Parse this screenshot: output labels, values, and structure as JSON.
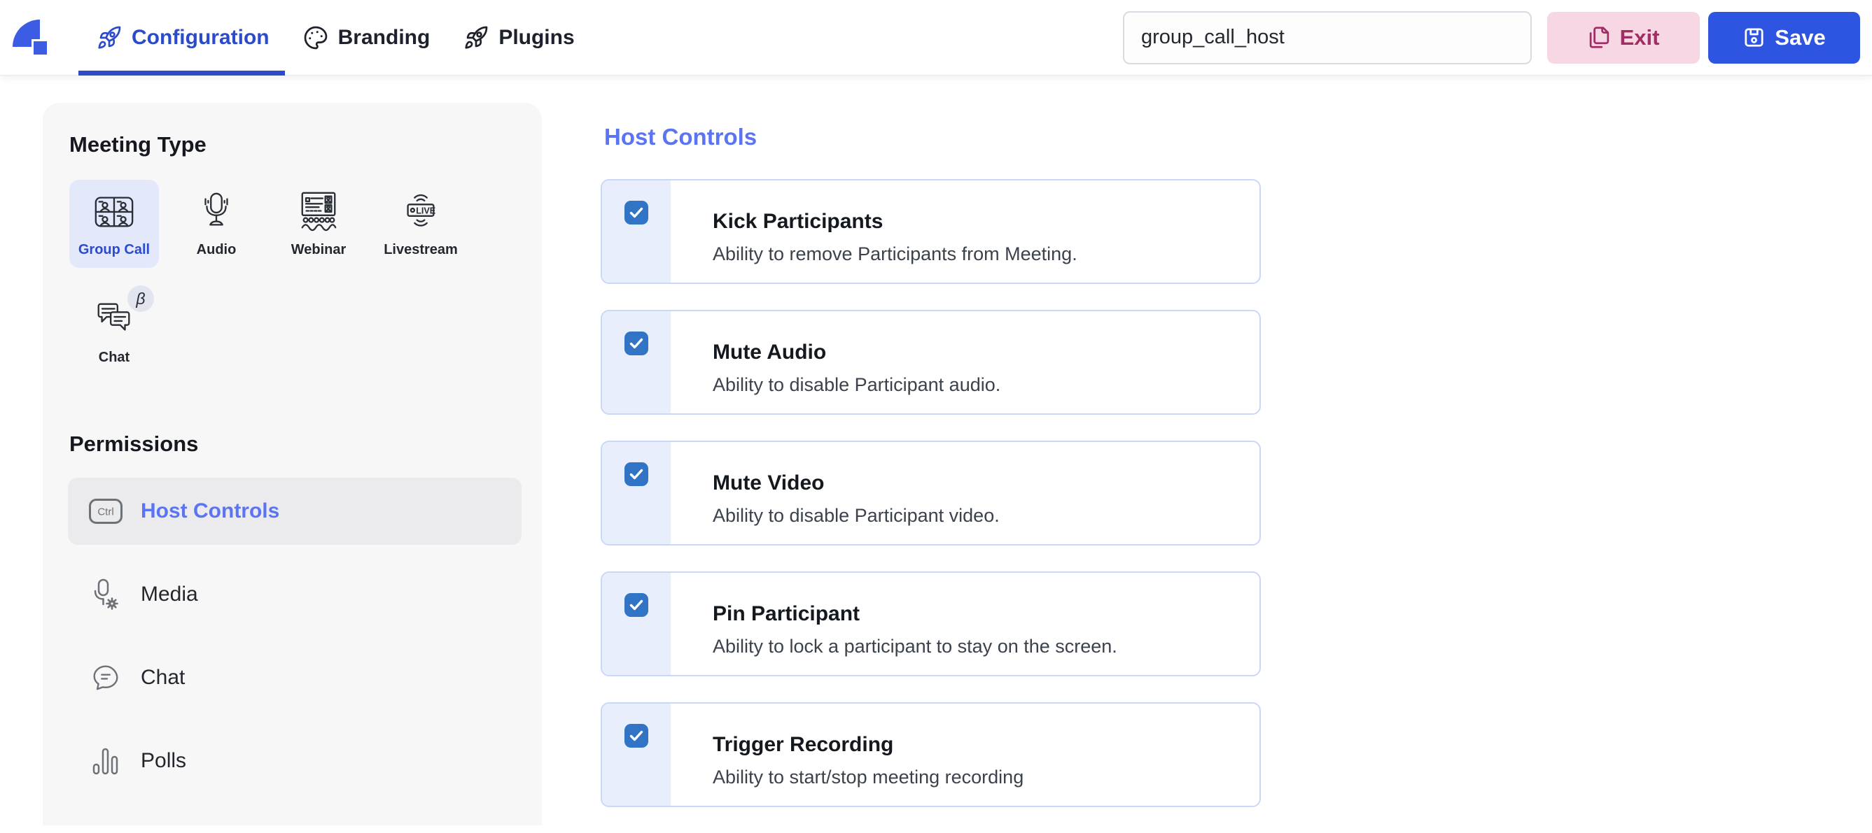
{
  "header": {
    "tabs": [
      {
        "label": "Configuration",
        "icon": "rocket-icon",
        "active": true
      },
      {
        "label": "Branding",
        "icon": "palette-icon",
        "active": false
      },
      {
        "label": "Plugins",
        "icon": "rocket-icon",
        "active": false
      }
    ],
    "preset_input": {
      "value": "group_call_host"
    },
    "exit_label": "Exit",
    "save_label": "Save"
  },
  "sidebar": {
    "meeting_type": {
      "title": "Meeting Type",
      "options": [
        {
          "label": "Group Call",
          "icon": "group-call-icon",
          "selected": true
        },
        {
          "label": "Audio",
          "icon": "microphone-icon",
          "selected": false
        },
        {
          "label": "Webinar",
          "icon": "webinar-icon",
          "selected": false
        },
        {
          "label": "Livestream",
          "icon": "livestream-icon",
          "selected": false
        },
        {
          "label": "Chat",
          "icon": "chat-bubbles-icon",
          "selected": false,
          "badge": "β"
        }
      ]
    },
    "permissions": {
      "title": "Permissions",
      "items": [
        {
          "label": "Host Controls",
          "icon": "ctrl-key-icon",
          "active": true
        },
        {
          "label": "Media",
          "icon": "mic-gear-icon",
          "active": false
        },
        {
          "label": "Chat",
          "icon": "chat-bubble-icon",
          "active": false
        },
        {
          "label": "Polls",
          "icon": "poll-bars-icon",
          "active": false
        }
      ]
    }
  },
  "main": {
    "heading": "Host Controls",
    "permissions": [
      {
        "title": "Kick Participants",
        "description": "Ability to remove Participants from Meeting.",
        "checked": true
      },
      {
        "title": "Mute Audio",
        "description": "Ability to disable Participant audio.",
        "checked": true
      },
      {
        "title": "Mute Video",
        "description": "Ability to disable Participant video.",
        "checked": true
      },
      {
        "title": "Pin Participant",
        "description": "Ability to lock a participant to stay on the screen.",
        "checked": true
      },
      {
        "title": "Trigger Recording",
        "description": "Ability to start/stop meeting recording",
        "checked": true
      }
    ]
  },
  "colors": {
    "accent": "#2b4bcb",
    "link": "#5b74f3",
    "logo": "#3c5ce4",
    "save-bg": "#2d55e2",
    "exit-bg": "#f8d7e4",
    "exit-text": "#9e2e63",
    "card-border": "#c9d8f6",
    "strip": "#e8eefc",
    "check": "#3173c5",
    "sidebar": "#f7f7f8",
    "active-item": "#ebebed",
    "tile-sel": "#e4e8fb"
  }
}
